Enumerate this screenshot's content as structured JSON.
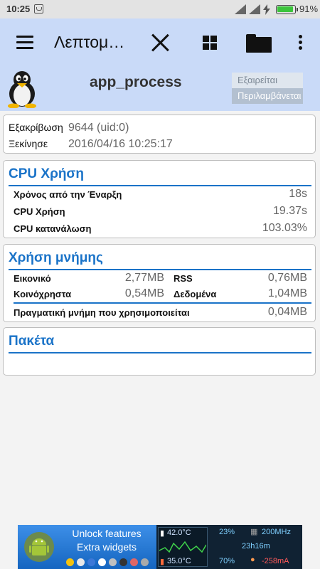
{
  "status_bar": {
    "time": "10:25",
    "battery_percent": "91%",
    "battery_level": 0.91,
    "icons": [
      "notification-icon",
      "signal-icon",
      "wifi-icon",
      "charging-icon",
      "battery-icon"
    ]
  },
  "toolbar": {
    "title": "Λεπτομ…",
    "icons": [
      "menu-icon",
      "close-icon",
      "grid-icon",
      "folder-icon",
      "more-icon"
    ]
  },
  "process": {
    "name": "app_process",
    "icon": "tux-icon",
    "excluded_label": "Εξαιρείται",
    "included_label": "Περιλαμβάνεται"
  },
  "info": {
    "priority_label": "Εξακρίβωση",
    "priority_value": "9644 (uid:0)",
    "started_label": "Ξεκίνησε",
    "started_value": "2016/04/16 10:25:17"
  },
  "cpu": {
    "title": "CPU Χρήση",
    "rows": [
      {
        "label": "Χρόνος από την Έναρξη",
        "value": "18s"
      },
      {
        "label": "CPU Χρήση",
        "value": "19.37s"
      },
      {
        "label": "CPU κατανάλωση",
        "value": "103.03%"
      }
    ]
  },
  "memory": {
    "title": "Χρήση μνήμης",
    "virtual_label": "Εικονικό",
    "virtual_value": "2,77MB",
    "rss_label": "RSS",
    "rss_value": "0,76MB",
    "shared_label": "Κοινόχρηστα",
    "shared_value": "0,54MB",
    "data_label": "Δεδομένα",
    "data_value": "1,04MB",
    "real_label": "Πραγματική μνήμη που χρησιμοποιείται",
    "real_value": "0,04MB"
  },
  "packages": {
    "title": "Πακέτα"
  },
  "ad": {
    "line1": "Unlock features",
    "line2": "Extra widgets",
    "temp1": "42.0°C",
    "temp2": "35.0°C",
    "cpu_pct": "23%",
    "freq": "200MHz",
    "uptime": "23h16m",
    "batt_pct": "70%",
    "current": "-258mA"
  },
  "colors": {
    "toolbar_bg": "#c9daf8",
    "accent": "#1a73c8",
    "value_gray": "#666666"
  }
}
